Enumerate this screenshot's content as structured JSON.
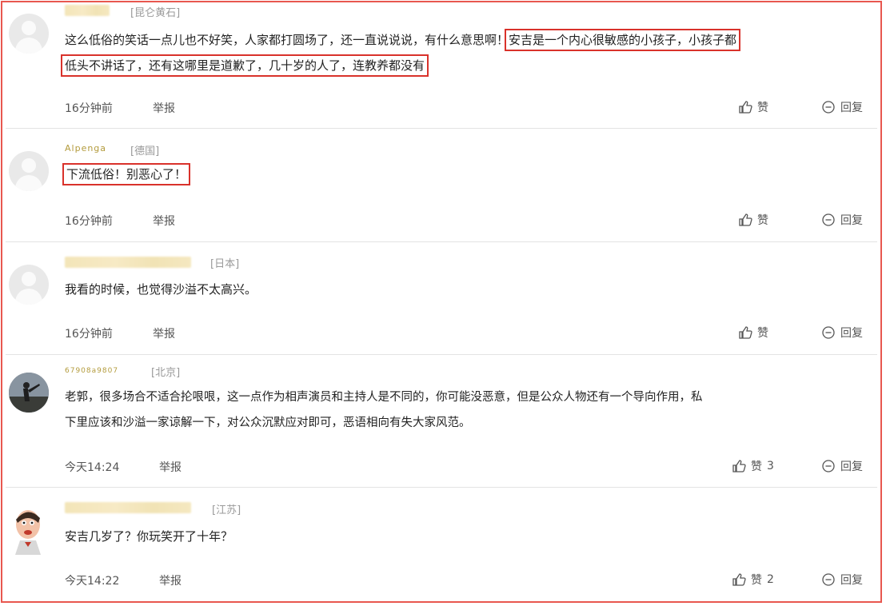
{
  "comments": [
    {
      "location": "[昆仑黄石]",
      "text_a": "这么低俗的笑话一点儿也不好笑，人家都打圆场了，还一直说说说，有什么意思啊！",
      "text_hl1": "安吉是一个内心很敏感的小孩子，小孩子都",
      "text_hl2": "低头不讲话了，还有这哪里是道歉了，几十岁的人了，连教养都没有",
      "time": "16分钟前",
      "report": "举报",
      "like": "赞",
      "reply": "回复"
    },
    {
      "username": "Alpenga",
      "location": "[德国]",
      "text": "下流低俗！别恶心了！",
      "time": "16分钟前",
      "report": "举报",
      "like": "赞",
      "reply": "回复"
    },
    {
      "location": "[日本]",
      "text": "我看的时候，也觉得沙溢不太高兴。",
      "time": "16分钟前",
      "report": "举报",
      "like": "赞",
      "reply": "回复"
    },
    {
      "username": "67908a9807",
      "location": "[北京]",
      "text_1": "老郭，很多场合不适合抡哏哏，这一点作为相声演员和主持人是不同的，你可能没恶意，但是公众人物还有一个导向作用，私",
      "text_2": "下里应该和沙溢一家谅解一下，对公众沉默应对即可，恶语相向有失大家风范。",
      "time": "今天14:24",
      "report": "举报",
      "like": "赞",
      "like_count": "3",
      "reply": "回复"
    },
    {
      "location": "[江苏]",
      "text": "安吉几岁了？你玩笑开了十年？",
      "time": "今天14:22",
      "report": "举报",
      "like": "赞",
      "like_count": "2",
      "reply": "回复"
    }
  ],
  "icons": {
    "like": "thumbs-up-icon",
    "reply": "reply-bubble-icon"
  },
  "colors": {
    "highlight_box": "#d9322b",
    "frame": "#e8574f"
  }
}
